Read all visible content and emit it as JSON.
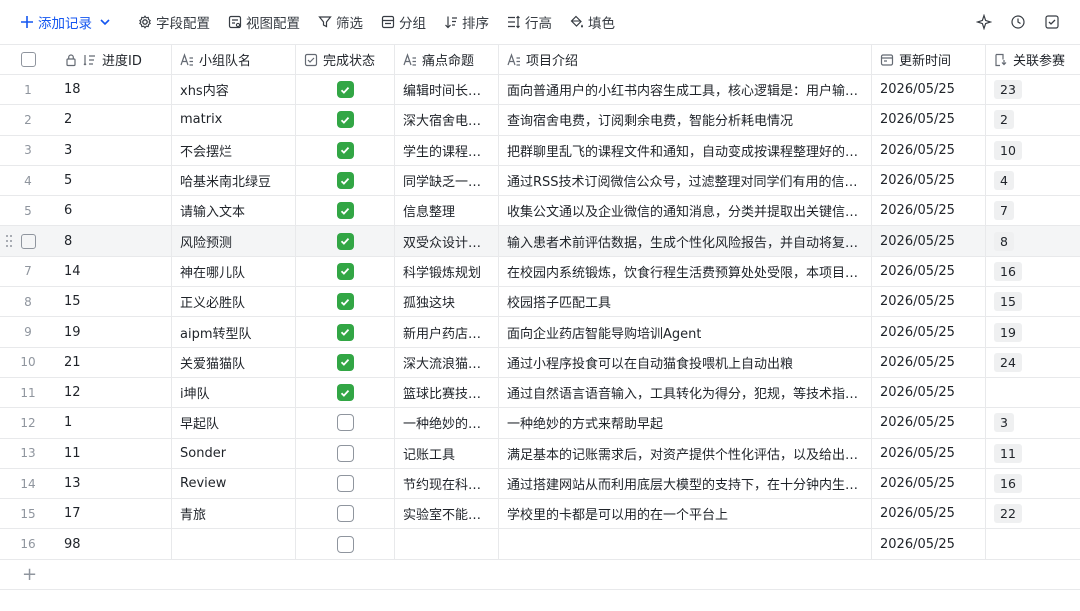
{
  "toolbar": {
    "add_record": "添加记录",
    "field_config": "字段配置",
    "view_config": "视图配置",
    "filter": "筛选",
    "group": "分组",
    "sort": "排序",
    "row_height": "行高",
    "fill": "填色",
    "accent_color": "#1456f0"
  },
  "columns": {
    "id": "进度ID",
    "name": "小组队名",
    "done": "完成状态",
    "pain": "痛点命题",
    "desc": "项目介绍",
    "time": "更新时间",
    "rel": "关联参赛"
  },
  "rows": [
    {
      "num": "1",
      "id": "18",
      "name": "xhs内容",
      "done": true,
      "pain": "编辑时间长…",
      "desc": "面向普通用户的小红书内容生成工具，核心逻辑是：用户输…",
      "time": "2026/05/25",
      "rel": "23"
    },
    {
      "num": "2",
      "id": "2",
      "name": "matrix",
      "done": true,
      "pain": "深大宿舍电…",
      "desc": "查询宿舍电费，订阅剩余电费，智能分析耗电情况",
      "time": "2026/05/25",
      "rel": "2"
    },
    {
      "num": "3",
      "id": "3",
      "name": "不会摆烂",
      "done": true,
      "pain": "学生的课程…",
      "desc": "把群聊里乱飞的课程文件和通知，自动变成按课程整理好的…",
      "time": "2026/05/25",
      "rel": "10"
    },
    {
      "num": "4",
      "id": "5",
      "name": "哈基米南北绿豆",
      "done": true,
      "pain": "同学缺乏一…",
      "desc": "通过RSS技术订阅微信公众号，过滤整理对同学们有用的信…",
      "time": "2026/05/25",
      "rel": "4"
    },
    {
      "num": "5",
      "id": "6",
      "name": "请输入文本",
      "done": true,
      "pain": "信息整理",
      "desc": "收集公文通以及企业微信的通知消息，分类并提取出关键信…",
      "time": "2026/05/25",
      "rel": "7"
    },
    {
      "num": "",
      "id": "8",
      "name": "风险预测",
      "done": true,
      "pain": "双受众设计…",
      "desc": "输入患者术前评估数据，生成个性化风险报告，并自动将复…",
      "time": "2026/05/25",
      "rel": "8",
      "hover": true
    },
    {
      "num": "7",
      "id": "14",
      "name": "神在哪儿队",
      "done": true,
      "pain": "科学锻炼规划",
      "desc": "在校园内系统锻炼，饮食行程生活费预算处处受限，本项目…",
      "time": "2026/05/25",
      "rel": "16"
    },
    {
      "num": "8",
      "id": "15",
      "name": "正义必胜队",
      "done": true,
      "pain": "孤独这块",
      "desc": "校园搭子匹配工具",
      "time": "2026/05/25",
      "rel": "15"
    },
    {
      "num": "9",
      "id": "19",
      "name": "aipm转型队",
      "done": true,
      "pain": "新用户药店…",
      "desc": "面向企业药店智能导购培训Agent",
      "time": "2026/05/25",
      "rel": "19"
    },
    {
      "num": "10",
      "id": "21",
      "name": "关爱猫猫队",
      "done": true,
      "pain": "深大流浪猫…",
      "desc": "通过小程序投食可以在自动猫食投喂机上自动出粮",
      "time": "2026/05/25",
      "rel": "24"
    },
    {
      "num": "11",
      "id": "12",
      "name": "i坤队",
      "done": true,
      "pain": "篮球比赛技…",
      "desc": "通过自然语言语音输入，工具转化为得分，犯规，等技术指…",
      "time": "2026/05/25",
      "rel": ""
    },
    {
      "num": "12",
      "id": "1",
      "name": "早起队",
      "done": false,
      "pain": "一种绝妙的…",
      "desc": "一种绝妙的方式来帮助早起",
      "time": "2026/05/25",
      "rel": "3"
    },
    {
      "num": "13",
      "id": "11",
      "name": "Sonder",
      "done": false,
      "pain": "记账工具",
      "desc": "满足基本的记账需求后，对资产提供个性化评估，以及给出…",
      "time": "2026/05/25",
      "rel": "11"
    },
    {
      "num": "14",
      "id": "13",
      "name": "Review",
      "done": false,
      "pain": "节约现在科…",
      "desc": "通过搭建网站从而利用底层大模型的支持下，在十分钟内生…",
      "time": "2026/05/25",
      "rel": "16"
    },
    {
      "num": "15",
      "id": "17",
      "name": "青旅",
      "done": false,
      "pain": "实验室不能…",
      "desc": "学校里的卡都是可以用的在一个平台上",
      "time": "2026/05/25",
      "rel": "22"
    },
    {
      "num": "16",
      "id": "98",
      "name": "",
      "done": false,
      "pain": "",
      "desc": "",
      "time": "2026/05/25",
      "rel": ""
    }
  ],
  "check_color": "#32a645"
}
